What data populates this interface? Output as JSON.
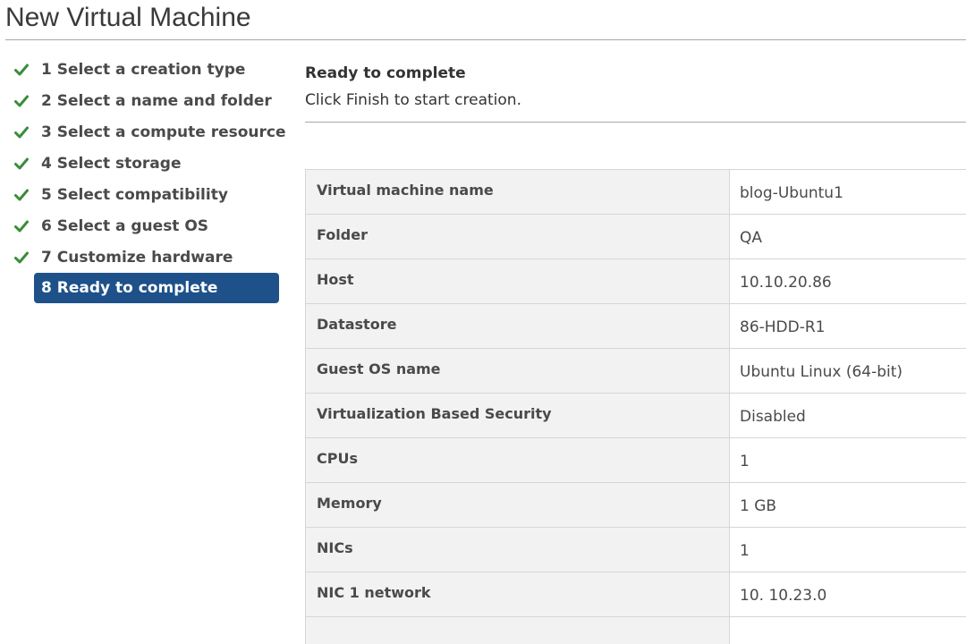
{
  "dialog": {
    "title": "New Virtual Machine"
  },
  "steps": [
    {
      "label": "1 Select a creation type",
      "status": "completed"
    },
    {
      "label": "2 Select a name and folder",
      "status": "completed"
    },
    {
      "label": "3 Select a compute resource",
      "status": "completed"
    },
    {
      "label": "4 Select storage",
      "status": "completed"
    },
    {
      "label": "5 Select compatibility",
      "status": "completed"
    },
    {
      "label": "6 Select a guest OS",
      "status": "completed"
    },
    {
      "label": "7 Customize hardware",
      "status": "completed"
    },
    {
      "label": "8 Ready to complete",
      "status": "active"
    }
  ],
  "content": {
    "title": "Ready to complete",
    "description": "Click Finish to start creation."
  },
  "summary": [
    {
      "key": "Virtual machine name",
      "value": "blog-Ubuntu1"
    },
    {
      "key": "Folder",
      "value": "QA"
    },
    {
      "key": "Host",
      "value": "10.10.20.86"
    },
    {
      "key": "Datastore",
      "value": "86-HDD-R1"
    },
    {
      "key": "Guest OS name",
      "value": "Ubuntu Linux (64-bit)"
    },
    {
      "key": "Virtualization Based Security",
      "value": "Disabled"
    },
    {
      "key": "CPUs",
      "value": "1"
    },
    {
      "key": "Memory",
      "value": "1 GB"
    },
    {
      "key": "NICs",
      "value": "1"
    },
    {
      "key": "NIC 1 network",
      "value": "10. 10.23.0"
    },
    {
      "key": "",
      "value": ""
    }
  ],
  "colors": {
    "accent": "#1e5189",
    "check": "#3a8c3a",
    "key_background": "#f2f2f2",
    "border": "#d6d6d6"
  },
  "icons": {
    "completed": "check-icon"
  }
}
